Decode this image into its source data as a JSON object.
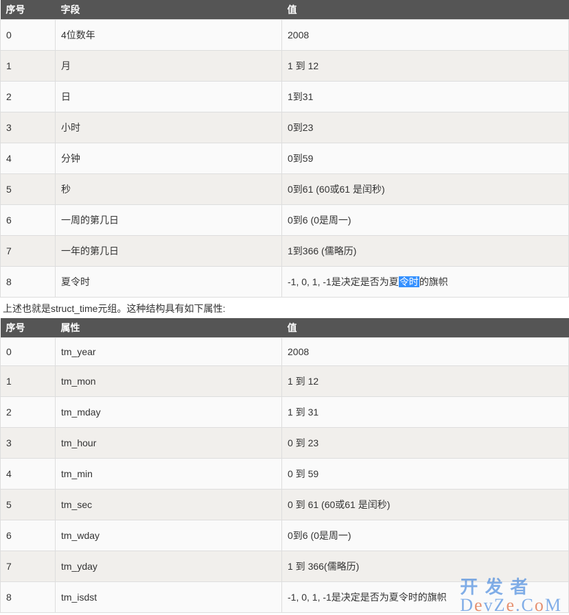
{
  "table1": {
    "headers": {
      "idx": "序号",
      "field": "字段",
      "value": "值"
    },
    "rows": [
      {
        "idx": "0",
        "field": "4位数年",
        "value": "2008"
      },
      {
        "idx": "1",
        "field": "月",
        "value": "1 到 12"
      },
      {
        "idx": "2",
        "field": "日",
        "value": "1到31"
      },
      {
        "idx": "3",
        "field": "小时",
        "value": "0到23"
      },
      {
        "idx": "4",
        "field": "分钟",
        "value": "0到59"
      },
      {
        "idx": "5",
        "field": "秒",
        "value": "0到61 (60或61 是闰秒)"
      },
      {
        "idx": "6",
        "field": "一周的第几日",
        "value": "0到6 (0是周一)"
      },
      {
        "idx": "7",
        "field": "一年的第几日",
        "value": "1到366 (儒略历)"
      },
      {
        "idx": "8",
        "field": "夏令时",
        "value_pre": "-1, 0, 1, -1是决定是否为夏",
        "value_hl": "令时",
        "value_post": "的旗帜"
      }
    ]
  },
  "mid_text": "上述也就是struct_time元组。这种结构具有如下属性:",
  "table2": {
    "headers": {
      "idx": "序号",
      "attr": "属性",
      "value": "值"
    },
    "rows": [
      {
        "idx": "0",
        "attr": "tm_year",
        "value": "2008"
      },
      {
        "idx": "1",
        "attr": "tm_mon",
        "value": "1 到 12"
      },
      {
        "idx": "2",
        "attr": "tm_mday",
        "value": "1 到 31"
      },
      {
        "idx": "3",
        "attr": "tm_hour",
        "value": "0 到 23"
      },
      {
        "idx": "4",
        "attr": "tm_min",
        "value": "0 到 59"
      },
      {
        "idx": "5",
        "attr": "tm_sec",
        "value": "0 到 61 (60或61 是闰秒)"
      },
      {
        "idx": "6",
        "attr": "tm_wday",
        "value": "0到6 (0是周一)"
      },
      {
        "idx": "7",
        "attr": "tm_yday",
        "value": "1 到 366(儒略历)"
      },
      {
        "idx": "8",
        "attr": "tm_isdst",
        "value": "-1, 0, 1, -1是决定是否为夏令时的旗帜"
      }
    ]
  },
  "watermark": {
    "line1": "开 发 者",
    "line2_a": "D",
    "line2_b": "e",
    "line2_c": "v",
    "line2_d": "Z",
    "line2_e": "e",
    "line2_f": ".C",
    "line2_g": "o",
    "line2_h": "M"
  }
}
